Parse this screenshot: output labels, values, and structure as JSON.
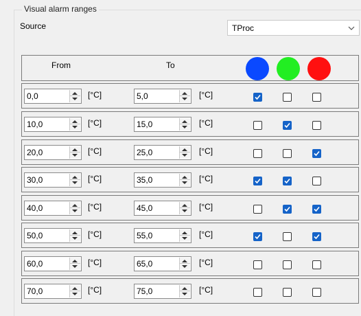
{
  "group": {
    "title": "Visual alarm ranges"
  },
  "source": {
    "label": "Source",
    "value": "TProc"
  },
  "header": {
    "from_label": "From",
    "to_label": "To",
    "colors": [
      {
        "icon": "blue-circle-icon",
        "hex": "#0a49ff"
      },
      {
        "icon": "green-circle-icon",
        "hex": "#22ee22"
      },
      {
        "icon": "red-circle-icon",
        "hex": "#ff1010"
      }
    ]
  },
  "rows": [
    {
      "from": "0,0",
      "from_unit": "[°C]",
      "to": "5,0",
      "to_unit": "[°C]",
      "blue": true,
      "green": false,
      "red": false
    },
    {
      "from": "10,0",
      "from_unit": "[°C]",
      "to": "15,0",
      "to_unit": "[°C]",
      "blue": false,
      "green": true,
      "red": false
    },
    {
      "from": "20,0",
      "from_unit": "[°C]",
      "to": "25,0",
      "to_unit": "[°C]",
      "blue": false,
      "green": false,
      "red": true
    },
    {
      "from": "30,0",
      "from_unit": "[°C]",
      "to": "35,0",
      "to_unit": "[°C]",
      "blue": true,
      "green": true,
      "red": false
    },
    {
      "from": "40,0",
      "from_unit": "[°C]",
      "to": "45,0",
      "to_unit": "[°C]",
      "blue": false,
      "green": true,
      "red": true
    },
    {
      "from": "50,0",
      "from_unit": "[°C]",
      "to": "55,0",
      "to_unit": "[°C]",
      "blue": true,
      "green": false,
      "red": true
    },
    {
      "from": "60,0",
      "from_unit": "[°C]",
      "to": "65,0",
      "to_unit": "[°C]",
      "blue": false,
      "green": false,
      "red": false
    },
    {
      "from": "70,0",
      "from_unit": "[°C]",
      "to": "75,0",
      "to_unit": "[°C]",
      "blue": false,
      "green": false,
      "red": false
    }
  ]
}
